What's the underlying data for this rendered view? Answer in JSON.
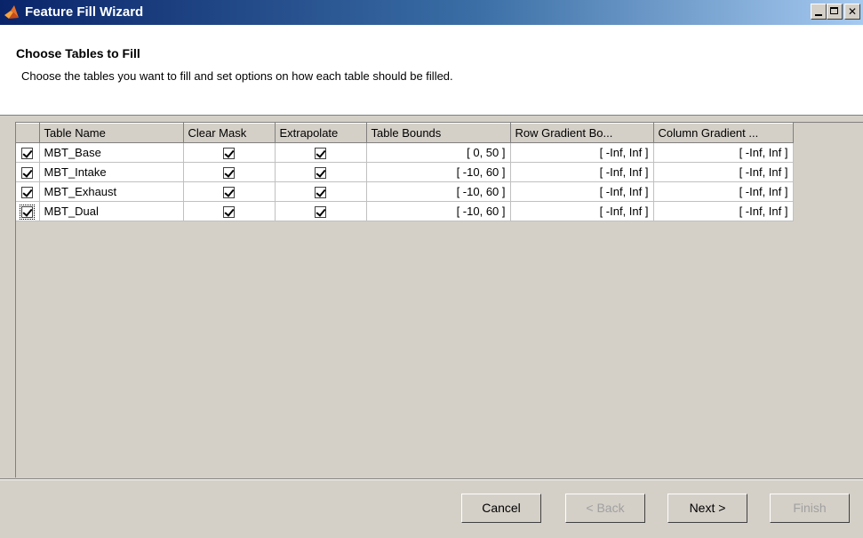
{
  "window": {
    "title": "Feature Fill Wizard",
    "controls": [
      "minimize",
      "maximize",
      "close"
    ]
  },
  "header": {
    "title": "Choose Tables to Fill",
    "description": "Choose the tables you want to fill and set options on how each table should be filled."
  },
  "table": {
    "columns": [
      "Table Name",
      "Clear Mask",
      "Extrapolate",
      "Table Bounds",
      "Row Gradient Bo...",
      "Column Gradient ..."
    ],
    "rows": [
      {
        "selected": true,
        "name": "MBT_Base",
        "clear_mask": true,
        "extrapolate": true,
        "table_bounds": "[ 0, 50 ]",
        "row_gradient": "[ -Inf, Inf ]",
        "column_gradient": "[ -Inf, Inf ]"
      },
      {
        "selected": true,
        "name": "MBT_Intake",
        "clear_mask": true,
        "extrapolate": true,
        "table_bounds": "[ -10, 60 ]",
        "row_gradient": "[ -Inf, Inf ]",
        "column_gradient": "[ -Inf, Inf ]"
      },
      {
        "selected": true,
        "name": "MBT_Exhaust",
        "clear_mask": true,
        "extrapolate": true,
        "table_bounds": "[ -10, 60 ]",
        "row_gradient": "[ -Inf, Inf ]",
        "column_gradient": "[ -Inf, Inf ]"
      },
      {
        "selected": true,
        "name": "MBT_Dual",
        "clear_mask": true,
        "extrapolate": true,
        "table_bounds": "[ -10, 60 ]",
        "row_gradient": "[ -Inf, Inf ]",
        "column_gradient": "[ -Inf, Inf ]"
      }
    ]
  },
  "buttons": {
    "cancel": "Cancel",
    "back": "< Back",
    "next": "Next >",
    "finish": "Finish"
  },
  "colors": {
    "titlebar_start": "#0a246a",
    "titlebar_end": "#a6caf0",
    "panel": "#d4d0c8",
    "app_icon": "#e8702a"
  }
}
